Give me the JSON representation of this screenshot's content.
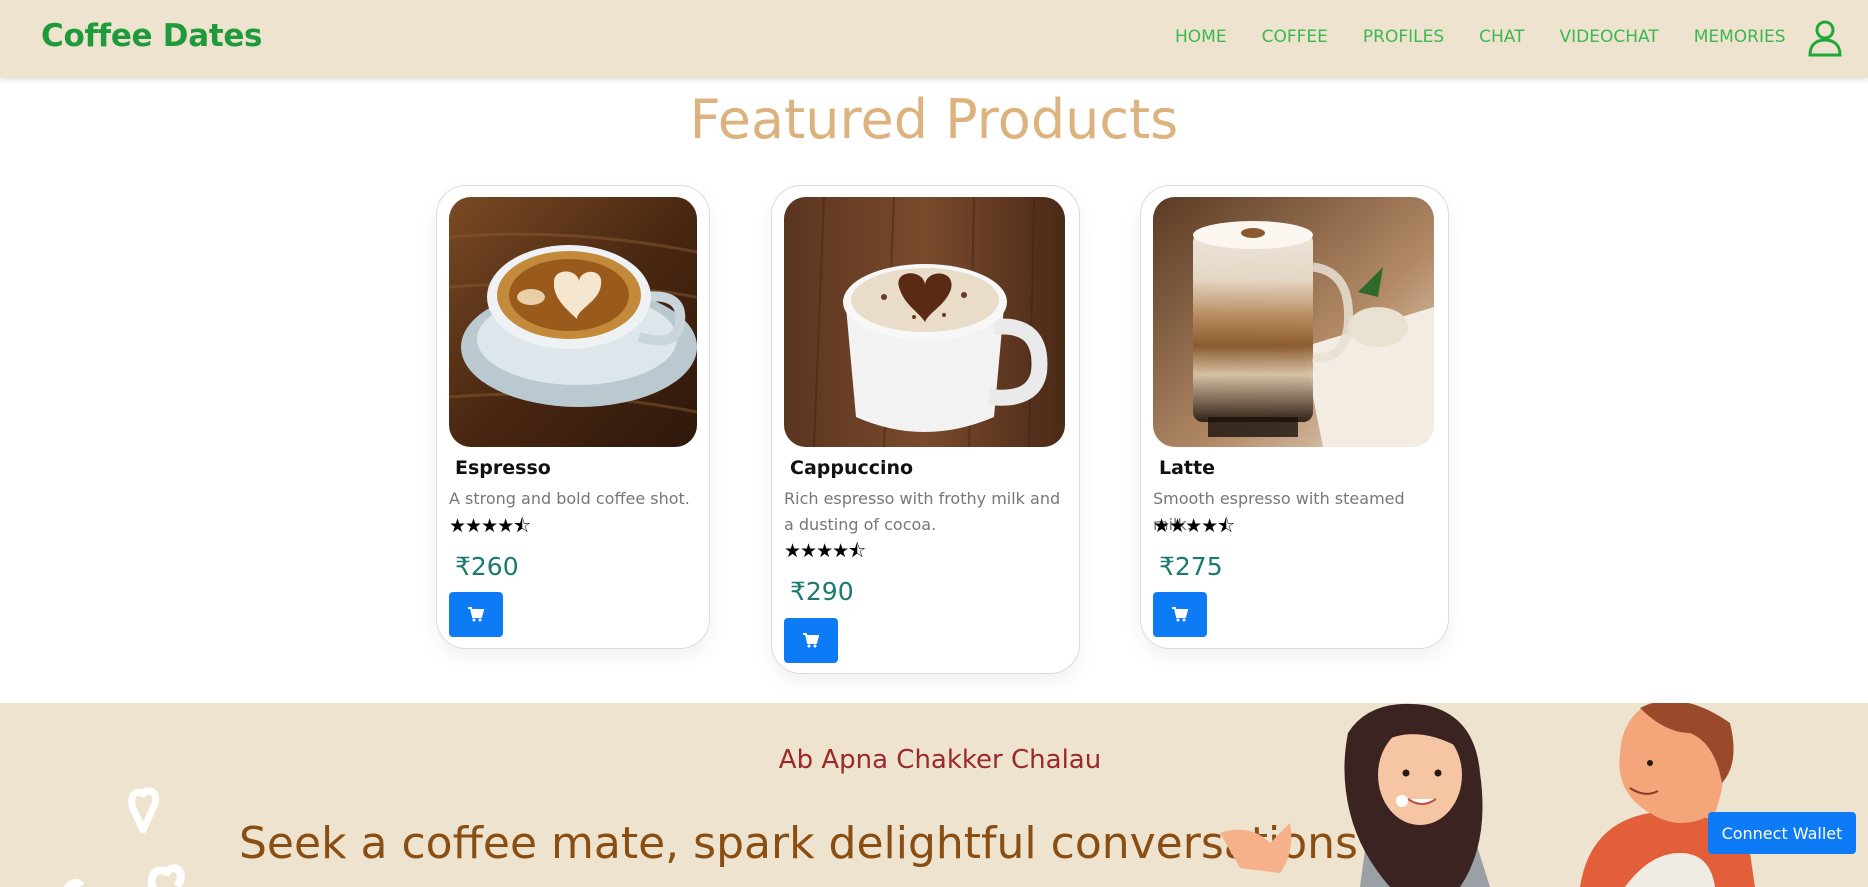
{
  "brand": "Coffee Dates",
  "nav": {
    "items": [
      "HOME",
      "COFFEE",
      "PROFILES",
      "CHAT",
      "VIDEOCHAT",
      "MEMORIES"
    ]
  },
  "section_title": "Featured Products",
  "products": [
    {
      "name": "Espresso",
      "description": "A strong and bold coffee shot.",
      "rating_stars": "★★★★⯪",
      "price": "₹260"
    },
    {
      "name": "Cappuccino",
      "description": "Rich espresso with frothy milk and a dusting of cocoa.",
      "rating_stars": "★★★★⯪",
      "price": "₹290"
    },
    {
      "name": "Latte",
      "description": "Smooth espresso with steamed milk.",
      "rating_stars": "★★★★⯪",
      "price": "₹275"
    }
  ],
  "hero": {
    "tagline": "Ab Apna Chakker Chalau",
    "headline": "Seek a coffee mate, spark delightful conversations"
  },
  "wallet_button": "Connect Wallet",
  "colors": {
    "nav_bg": "#ede3cf",
    "brand": "#1f9a3a",
    "nav_link": "#3cb84f",
    "title": "#dcb37f",
    "price": "#1a7a6f",
    "primary_button": "#0d7bf5",
    "tagline": "#9b2929",
    "headline": "#8a4d12"
  },
  "icons": [
    "user-icon",
    "cart-icon",
    "heart-doodle-icon"
  ]
}
